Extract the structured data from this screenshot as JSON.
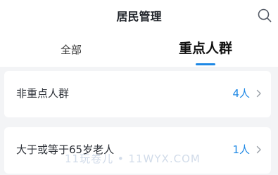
{
  "header": {
    "title": "居民管理",
    "search_icon": "search-icon"
  },
  "tabs": [
    {
      "label": "全部",
      "active": false
    },
    {
      "label": "重点人群",
      "active": true
    }
  ],
  "list": [
    {
      "label": "非重点人群",
      "count": "4人",
      "chevron_icon": "chevron-right-icon"
    },
    {
      "label": "大于或等于65岁老人",
      "count": "1人",
      "chevron_icon": "chevron-right-icon"
    }
  ],
  "watermark": "11玩卷儿 • 11WYX.COM",
  "colors": {
    "accent": "#1e88e5",
    "background": "#f3f4f6",
    "card": "#ffffff"
  }
}
